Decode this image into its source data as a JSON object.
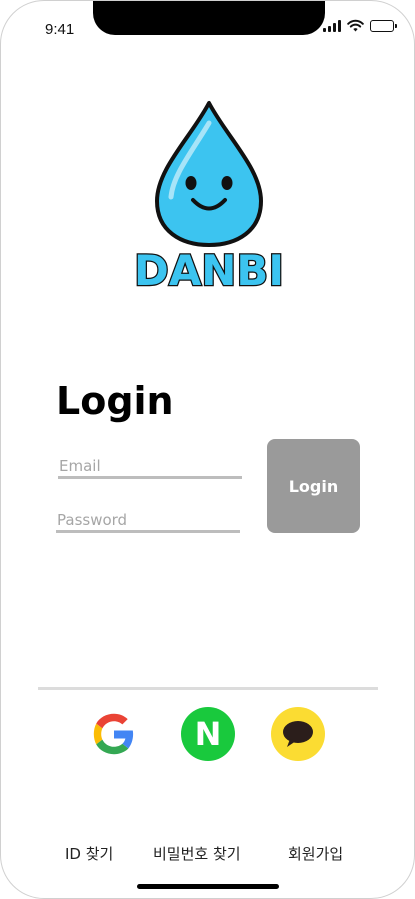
{
  "status_bar": {
    "time": "9:41"
  },
  "logo": {
    "text": "DANBI",
    "drop_color": "#3cc4f0",
    "text_color": "#3cc4f0"
  },
  "login": {
    "title": "Login",
    "email_placeholder": "Email",
    "password_placeholder": "Password",
    "button_label": "Login",
    "button_color": "#9a9a9a"
  },
  "social": {
    "google_icon": "google-icon",
    "naver_letter": "N",
    "naver_color": "#19c93d",
    "kakao_icon": "speech-bubble-icon",
    "kakao_color": "#fbdc32"
  },
  "footer": {
    "find_id": "ID 찾기",
    "find_password": "비밀번호 찾기",
    "sign_up": "회원가입"
  }
}
